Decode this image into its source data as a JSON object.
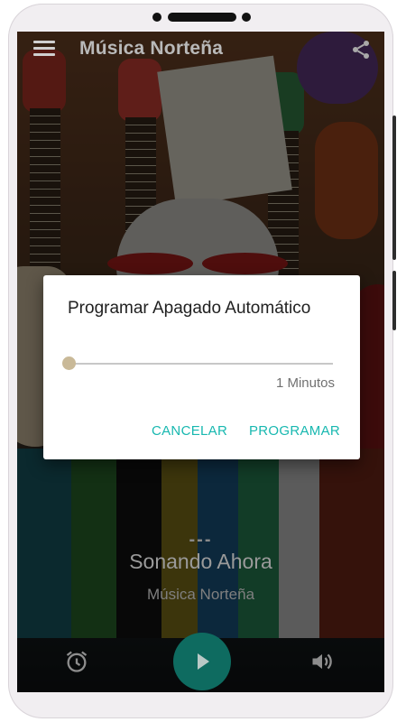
{
  "app": {
    "title": "Música Norteña",
    "icons": {
      "menu": "menu-icon",
      "share": "share-icon"
    }
  },
  "player": {
    "track_placeholder": "---",
    "now_playing_label": "Sonando Ahora",
    "station_name": "Música Norteña",
    "icons": {
      "alarm": "alarm-clock-icon",
      "play": "play-icon",
      "volume": "volume-icon"
    }
  },
  "dialog": {
    "title": "Programar Apagado Automático",
    "slider_value_text": "1 Minutos",
    "slider_level": 0.0,
    "cancel_label": "CANCELAR",
    "confirm_label": "PROGRAMAR"
  },
  "colors": {
    "accent": "#18b8b0",
    "play_button": "#0e6b60",
    "slider_thumb": "#c9b998",
    "dialog_bg": "#ffffff"
  }
}
